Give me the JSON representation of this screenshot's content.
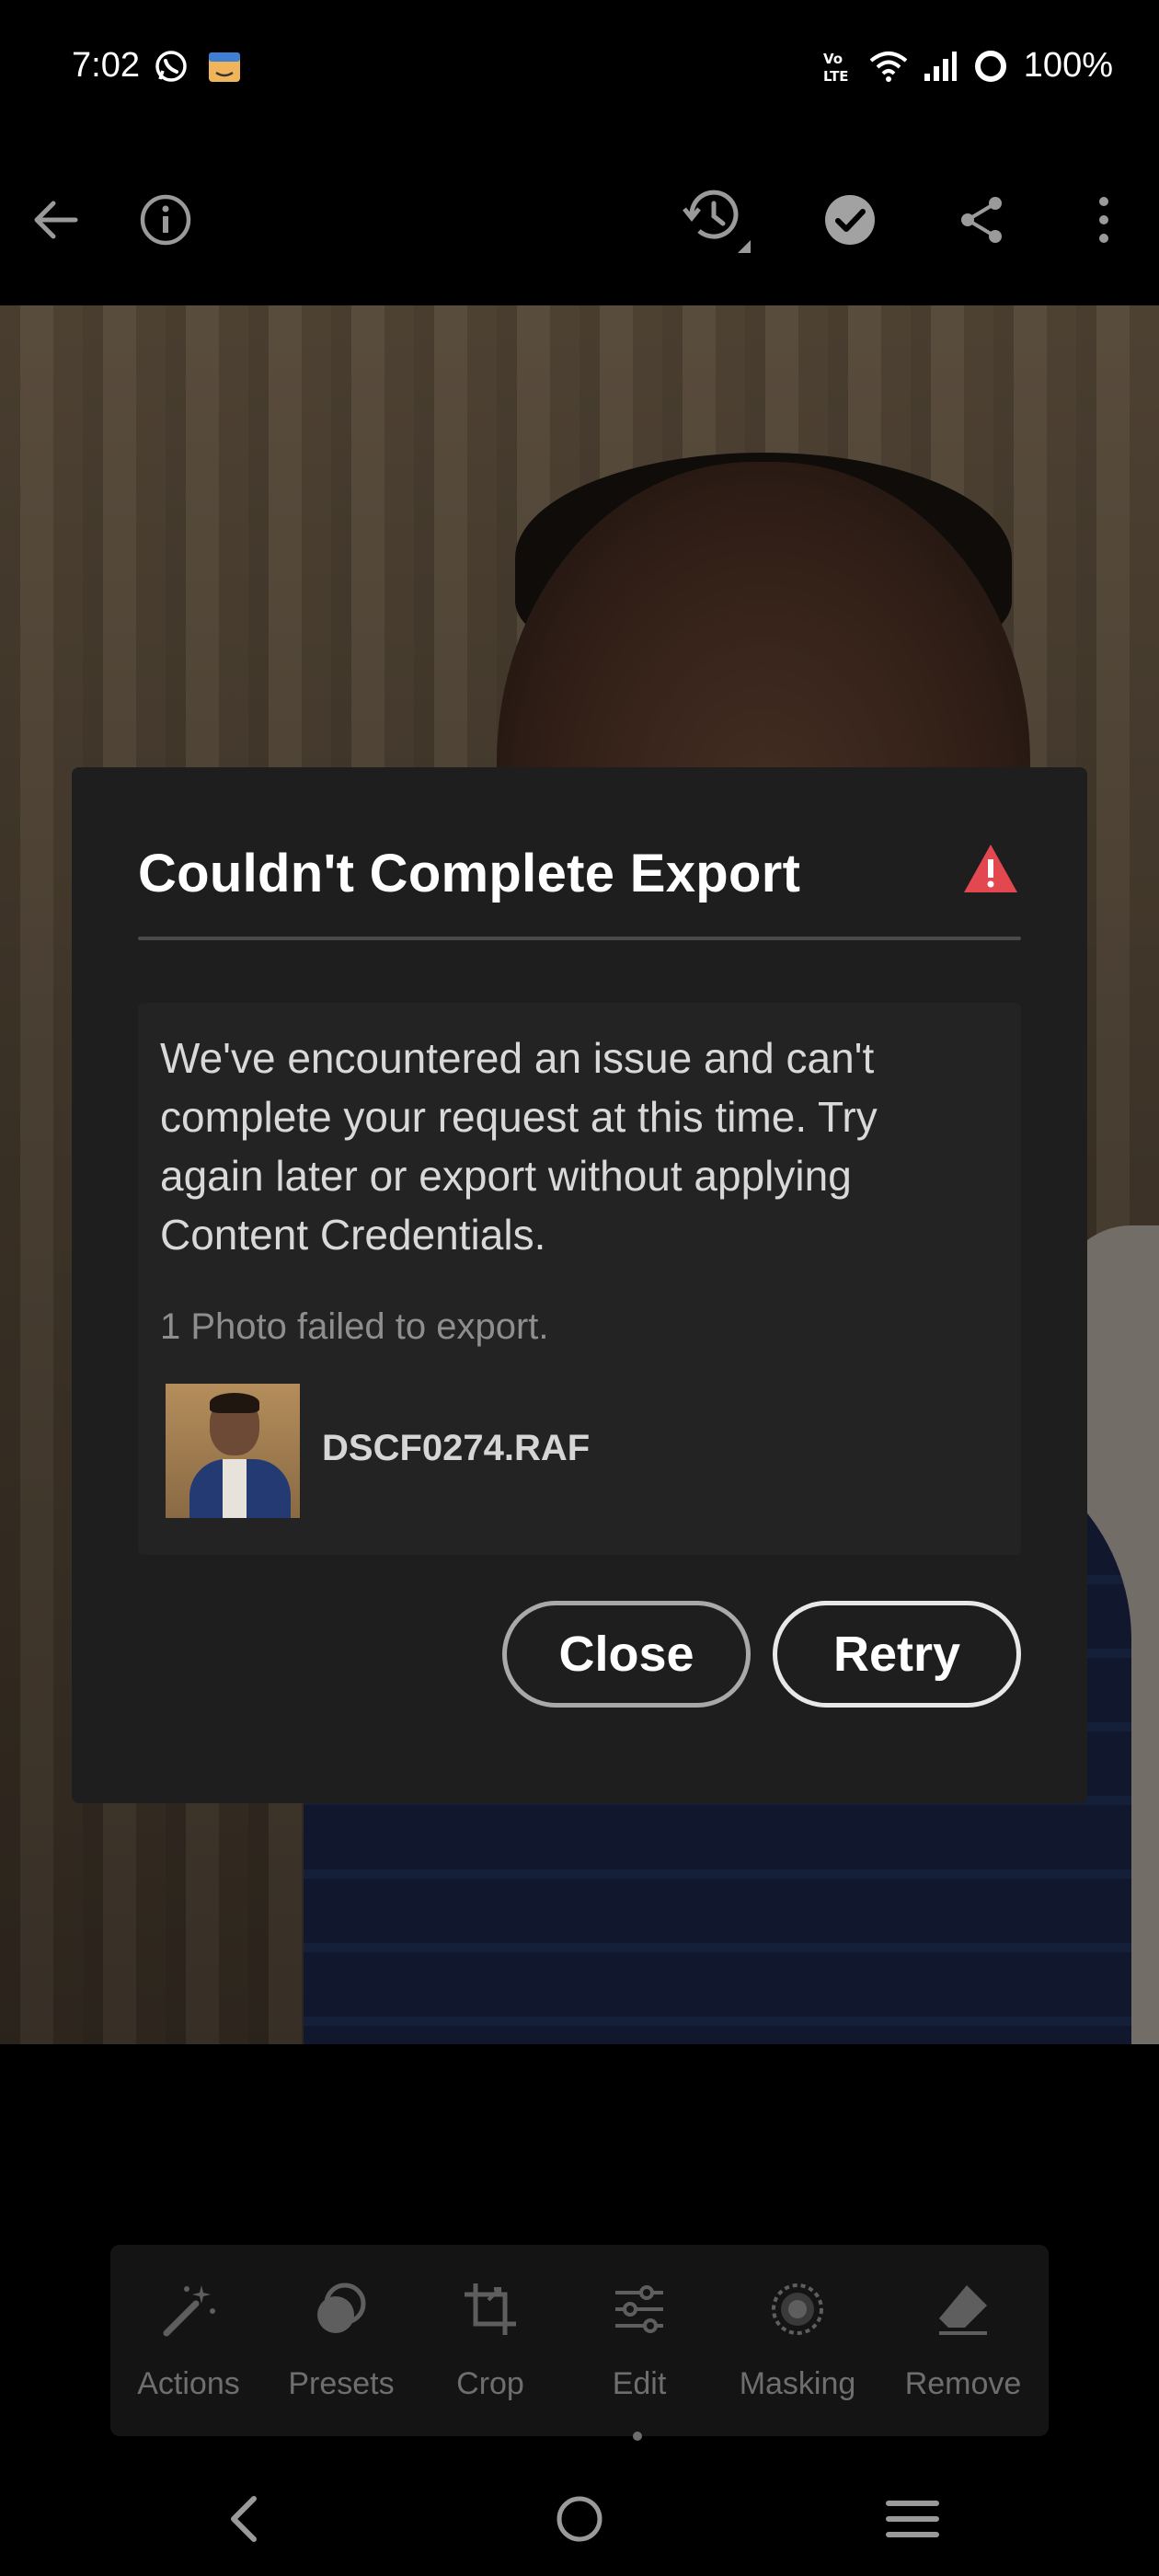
{
  "status_bar": {
    "time": "7:02",
    "battery": "100%",
    "icons": [
      "whatsapp-icon",
      "amazon-package-icon",
      "volte-icon",
      "wifi-icon",
      "signal-icon",
      "battery-ring-icon"
    ]
  },
  "top_bar": {
    "icons": [
      "back-arrow-icon",
      "info-icon",
      "history-icon",
      "check-circle-icon",
      "share-icon",
      "more-vertical-icon"
    ]
  },
  "dialog": {
    "title": "Couldn't Complete Export",
    "message": "We've encountered an issue and can't complete your request at this time. Try again later or export without applying Content Credentials.",
    "sub_message": "1 Photo failed to export.",
    "file_name": "DSCF0274.RAF",
    "close_label": "Close",
    "retry_label": "Retry",
    "alert_color": "#e34850"
  },
  "tools": {
    "items": [
      {
        "label": "Actions",
        "icon": "magic-wand-icon"
      },
      {
        "label": "Presets",
        "icon": "presets-icon"
      },
      {
        "label": "Crop",
        "icon": "crop-icon"
      },
      {
        "label": "Edit",
        "icon": "sliders-icon"
      },
      {
        "label": "Masking",
        "icon": "masking-icon"
      },
      {
        "label": "Remove",
        "icon": "eraser-icon"
      }
    ]
  },
  "nav_bar": {
    "icons": [
      "nav-back-icon",
      "nav-home-icon",
      "nav-recents-icon"
    ]
  }
}
